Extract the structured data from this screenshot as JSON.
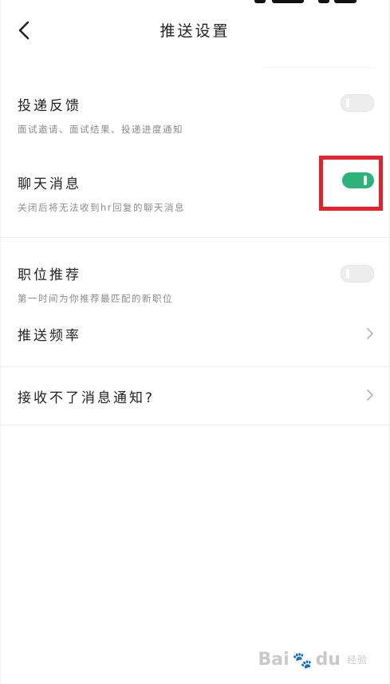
{
  "header": {
    "title": "推送设置",
    "back_icon": "chevron-left-icon"
  },
  "settings": {
    "delivery_feedback": {
      "title": "投递反馈",
      "subtitle": "面试邀请、面试结果、投递进度通知",
      "enabled": false
    },
    "chat_messages": {
      "title": "聊天消息",
      "subtitle": "关闭后将无法收到hr回复的聊天消息",
      "enabled": true
    },
    "job_recommend": {
      "title": "职位推荐",
      "subtitle": "第一时间为你推荐最匹配的新职位",
      "enabled": false
    },
    "push_frequency": {
      "title": "推送频率",
      "icon": "chevron-right-icon"
    },
    "cannot_receive": {
      "title": "接收不了消息通知?",
      "icon": "chevron-right-icon"
    }
  },
  "colors": {
    "toggle_on": "#2bb37a",
    "toggle_off": "#ededed",
    "highlight": "#e8202a"
  },
  "watermark": {
    "brand_a": "Bai",
    "brand_b": "du",
    "suffix": "经验"
  }
}
